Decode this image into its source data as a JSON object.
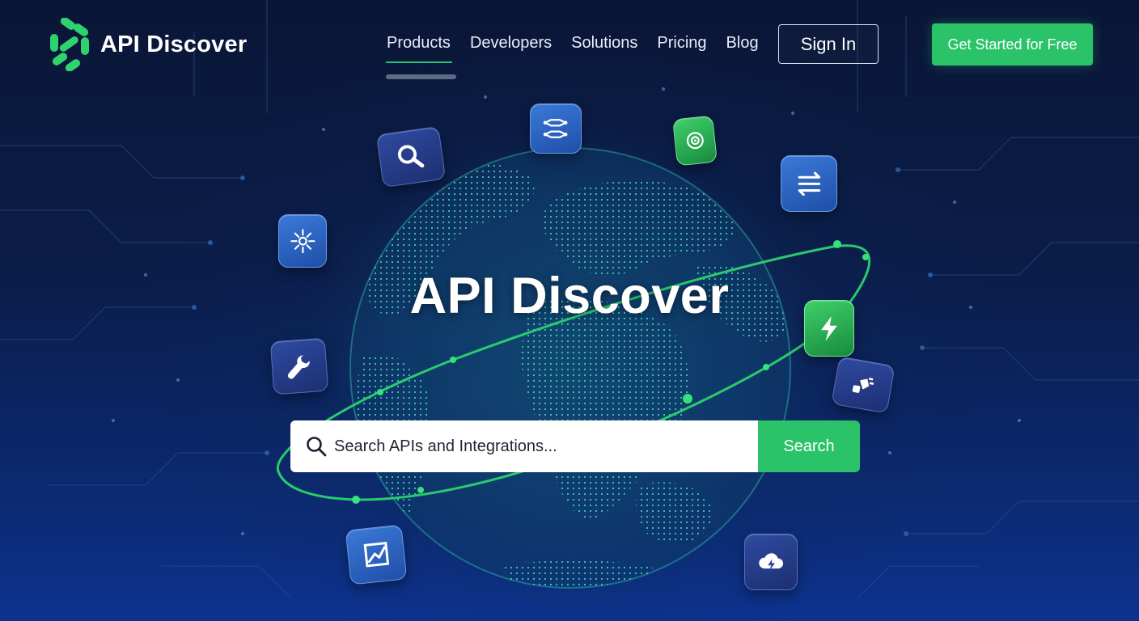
{
  "brand": {
    "name": "API Discover"
  },
  "nav": {
    "items": [
      {
        "label": "Products",
        "active": true
      },
      {
        "label": "Developers"
      },
      {
        "label": "Solutions"
      },
      {
        "label": "Pricing"
      },
      {
        "label": "Blog"
      }
    ],
    "signin_label": "Sign In",
    "cta_label": "Get Started for Free"
  },
  "hero": {
    "title": "API Discover",
    "search": {
      "placeholder": "Search APIs and Integrations...",
      "button_label": "Search"
    }
  },
  "floating_icons": [
    "search-icon",
    "branching-icon",
    "target-icon",
    "transfer-arrows-icon",
    "network-hub-icon",
    "lightning-icon",
    "wrench-icon",
    "plug-icon",
    "analytics-chart-icon",
    "cloud-lightning-icon"
  ],
  "colors": {
    "accent": "#2bc36a",
    "background_top": "#0a1636",
    "background_bottom": "#0d3390",
    "globe": "#37e0b4"
  }
}
